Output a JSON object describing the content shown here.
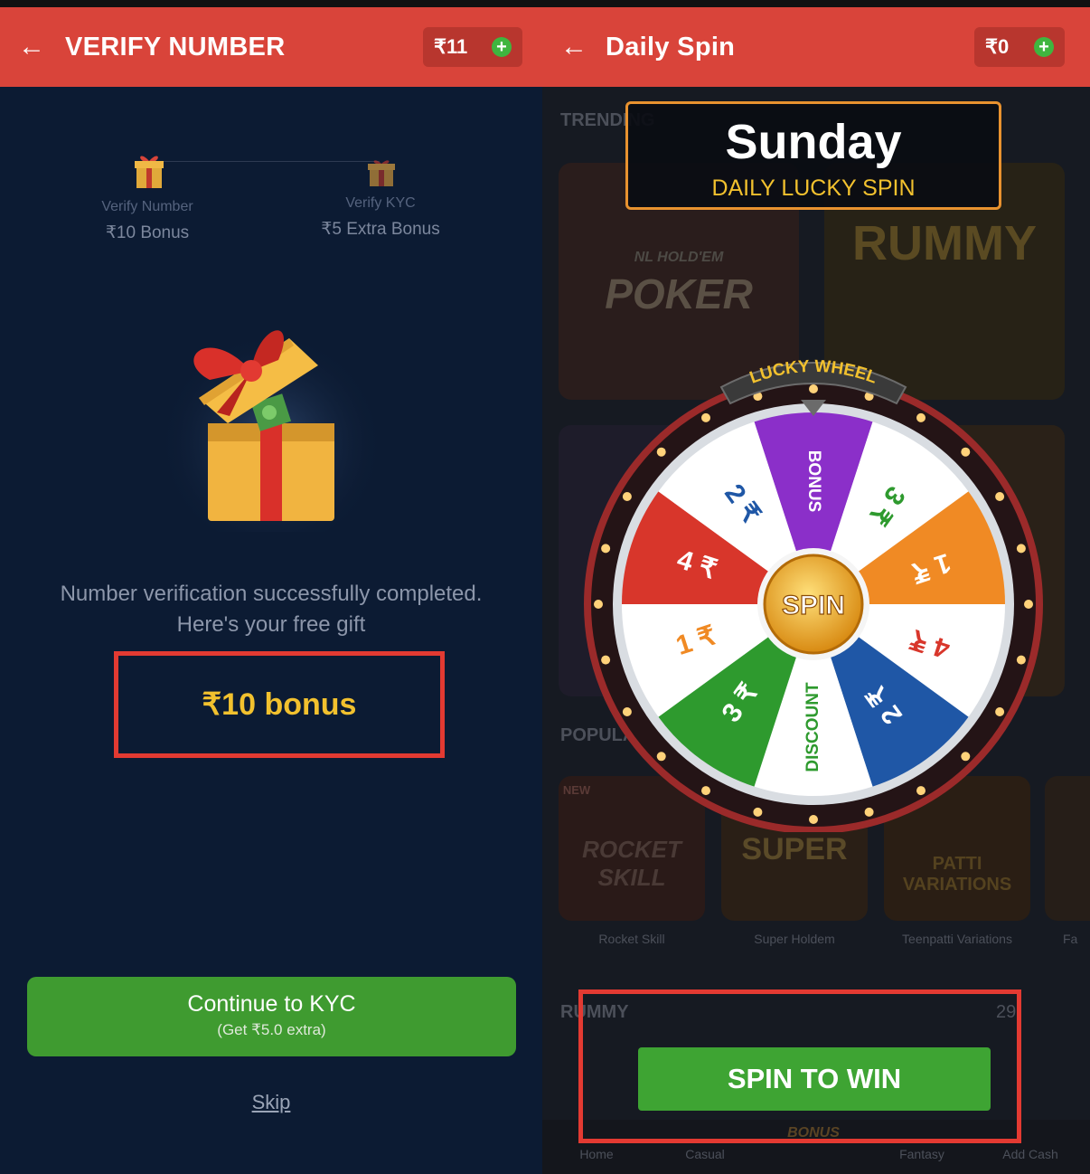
{
  "left": {
    "header": {
      "title": "VERIFY NUMBER",
      "wallet_amount": "₹11"
    },
    "steps": [
      {
        "label": "Verify Number",
        "bonus": "₹10 Bonus"
      },
      {
        "label": "Verify KYC",
        "bonus": "₹5 Extra Bonus"
      }
    ],
    "message": "Number verification successfully completed. Here's your free gift",
    "bonus": "₹10 bonus",
    "continue_button": {
      "label": "Continue to KYC",
      "sub": "(Get ₹5.0 extra)"
    },
    "skip": "Skip"
  },
  "right": {
    "header": {
      "title": "Daily Spin",
      "wallet_amount": "₹0"
    },
    "day": "Sunday",
    "subtitle": "DAILY LUCKY SPIN",
    "wheel_title": "LUCKY WHEEL",
    "wheel_center": "SPIN",
    "segments": [
      {
        "label": "BONUS",
        "color": "#8b2fc9",
        "text_color": "#ffffff"
      },
      {
        "label": "3 ₹",
        "color": "#ffffff",
        "text_color": "#2e9a2e"
      },
      {
        "label": "1 ₹",
        "color": "#f08a24",
        "text_color": "#ffffff"
      },
      {
        "label": "4 ₹",
        "color": "#ffffff",
        "text_color": "#d8362b"
      },
      {
        "label": "2 ₹",
        "color": "#1f57a6",
        "text_color": "#ffffff"
      },
      {
        "label": "DISCOUNT",
        "color": "#ffffff",
        "text_color": "#2e9a2e"
      },
      {
        "label": "3 ₹",
        "color": "#2e9a2e",
        "text_color": "#ffffff"
      },
      {
        "label": "1 ₹",
        "color": "#ffffff",
        "text_color": "#f08a24"
      },
      {
        "label": "4 ₹",
        "color": "#d8362b",
        "text_color": "#ffffff"
      },
      {
        "label": "2 ₹",
        "color": "#ffffff",
        "text_color": "#1f57a6"
      }
    ],
    "background": {
      "trending": "TRENDING",
      "popular": "POPULAR",
      "rummy_section": "RUMMY",
      "rummy_count": "29",
      "poker_top": "NL HOLD'EM",
      "poker": "POKER",
      "rummy_card": "RUMMY",
      "new_badge": "NEW",
      "games": [
        "Rocket Skill",
        "Super Holdem",
        "Teenpatti Variations",
        "Fa"
      ],
      "game_art": [
        "ROCKET SKILL",
        "SUPER",
        "PATTI VARIATIONS"
      ],
      "nav": [
        "Home",
        "Casual",
        "BONUS",
        "Fantasy",
        "Add Cash"
      ]
    },
    "spin_button": "SPIN TO WIN"
  }
}
